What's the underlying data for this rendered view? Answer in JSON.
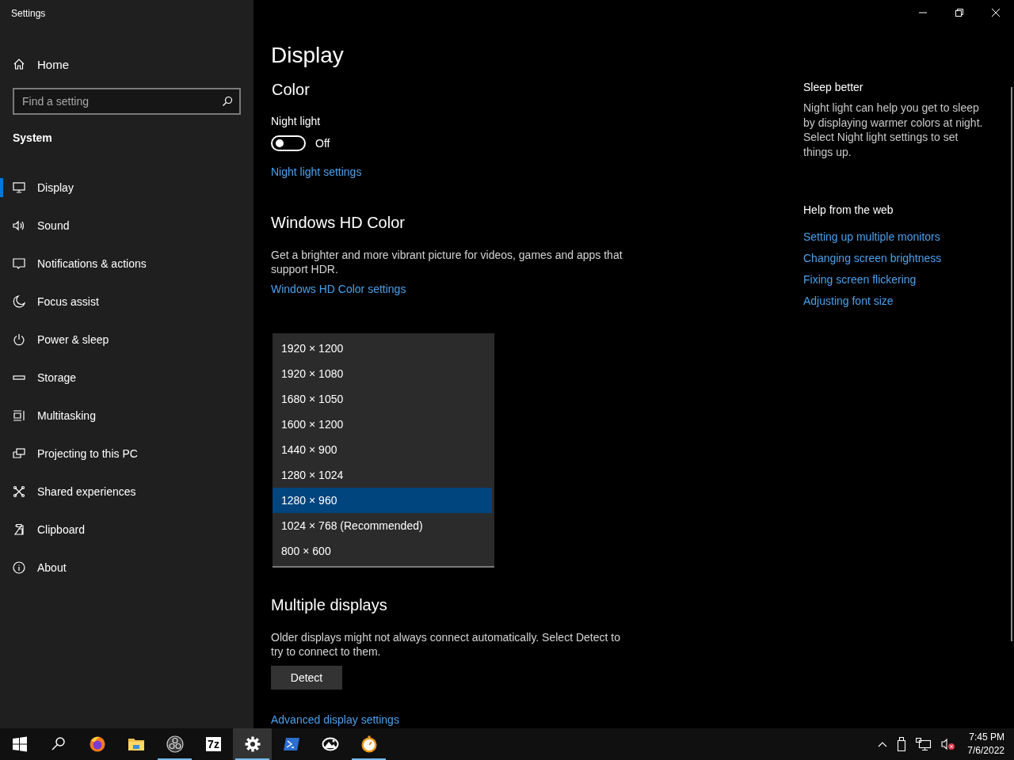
{
  "window": {
    "title": "Settings"
  },
  "sidebar": {
    "home": "Home",
    "search": {
      "placeholder": "Find a setting"
    },
    "section": "System",
    "items": [
      {
        "label": "Display",
        "kind": "display",
        "selected": true
      },
      {
        "label": "Sound",
        "kind": "sound",
        "selected": false
      },
      {
        "label": "Notifications & actions",
        "kind": "notifications",
        "selected": false
      },
      {
        "label": "Focus assist",
        "kind": "focus",
        "selected": false
      },
      {
        "label": "Power & sleep",
        "kind": "power",
        "selected": false
      },
      {
        "label": "Storage",
        "kind": "storage",
        "selected": false
      },
      {
        "label": "Multitasking",
        "kind": "multitasking",
        "selected": false
      },
      {
        "label": "Projecting to this PC",
        "kind": "projecting",
        "selected": false
      },
      {
        "label": "Shared experiences",
        "kind": "shared",
        "selected": false
      },
      {
        "label": "Clipboard",
        "kind": "clipboard",
        "selected": false
      },
      {
        "label": "About",
        "kind": "about",
        "selected": false
      }
    ]
  },
  "page": {
    "title": "Display",
    "color": {
      "heading": "Color",
      "night_light": {
        "label": "Night light",
        "on": false,
        "state_text": "Off"
      },
      "link": "Night light settings"
    },
    "hdr": {
      "heading": "Windows HD Color",
      "description": "Get a brighter and more vibrant picture for videos, games and apps that support HDR.",
      "link": "Windows HD Color settings"
    },
    "resolution_dropdown": {
      "options": [
        {
          "label": "1920 × 1200",
          "selected": false
        },
        {
          "label": "1920 × 1080",
          "selected": false
        },
        {
          "label": "1680 × 1050",
          "selected": false
        },
        {
          "label": "1600 × 1200",
          "selected": false
        },
        {
          "label": "1440 × 900",
          "selected": false
        },
        {
          "label": "1280 × 1024",
          "selected": false
        },
        {
          "label": "1280 × 960",
          "selected": true
        },
        {
          "label": "1024 × 768 (Recommended)",
          "selected": false
        },
        {
          "label": "800 × 600",
          "selected": false
        }
      ]
    },
    "multiple_displays": {
      "heading": "Multiple displays",
      "description": "Older displays might not always connect automatically. Select Detect to try to connect to them.",
      "button": "Detect"
    },
    "advanced_link": "Advanced display settings"
  },
  "aside": {
    "sleep": {
      "heading": "Sleep better",
      "text": "Night light can help you get to sleep by displaying warmer colors at night. Select Night light settings to set things up."
    },
    "help": {
      "heading": "Help from the web",
      "links": [
        "Setting up multiple monitors",
        "Changing screen brightness",
        "Fixing screen flickering",
        "Adjusting font size"
      ]
    }
  },
  "taskbar": {
    "apps": [
      {
        "kind": "start",
        "running": false,
        "active": false
      },
      {
        "kind": "search",
        "running": false,
        "active": false
      },
      {
        "kind": "browser",
        "running": false,
        "active": false
      },
      {
        "kind": "folder",
        "running": false,
        "active": false
      },
      {
        "kind": "obs",
        "running": true,
        "active": false
      },
      {
        "kind": "archiver",
        "text": "7z",
        "running": false,
        "active": false
      },
      {
        "kind": "settings",
        "running": true,
        "active": true
      },
      {
        "kind": "terminal",
        "running": false,
        "active": false
      },
      {
        "kind": "photos",
        "running": false,
        "active": false
      },
      {
        "kind": "clock",
        "running": true,
        "active": false
      }
    ],
    "clock": {
      "time": "7:45 PM",
      "date": "7/6/2022"
    }
  }
}
